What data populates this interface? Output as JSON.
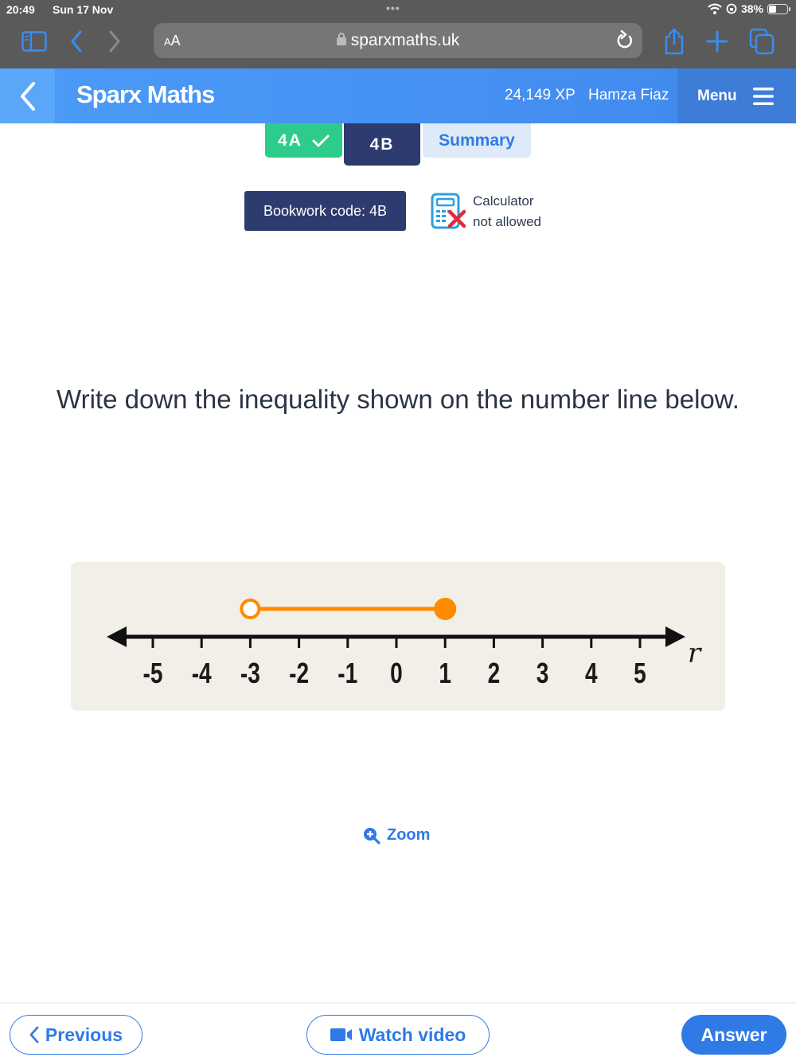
{
  "status_bar": {
    "time": "20:49",
    "date": "Sun 17 Nov",
    "battery": "38%",
    "battery_level": 0.38
  },
  "browser": {
    "text_size_label": "AA",
    "url": "sparxmaths.uk"
  },
  "header": {
    "brand": "Sparx Maths",
    "xp": "24,149 XP",
    "user_name": "Hamza Fiaz",
    "menu_label": "Menu"
  },
  "tabs": [
    {
      "label": "4A",
      "status": "complete"
    },
    {
      "label": "4B",
      "status": "active"
    },
    {
      "label": "Summary",
      "status": "inactive"
    }
  ],
  "bookwork": {
    "label": "Bookwork code: 4B"
  },
  "calculator": {
    "line1": "Calculator",
    "line2": "not allowed"
  },
  "question": {
    "text": "Write down the inequality shown on the number line below."
  },
  "number_line": {
    "min": -5,
    "max": 5,
    "ticks": [
      "-5",
      "-4",
      "-3",
      "-2",
      "-1",
      "0",
      "1",
      "2",
      "3",
      "4",
      "5"
    ],
    "variable": "r",
    "interval": {
      "start": -3,
      "start_type": "open",
      "end": 1,
      "end_type": "closed"
    },
    "colors": {
      "interval": "#ff8a00",
      "axis": "#111111"
    }
  },
  "zoom": {
    "label": "Zoom"
  },
  "footer": {
    "previous_label": "Previous",
    "watch_video_label": "Watch video",
    "answer_label": "Answer"
  },
  "colors": {
    "brand_blue": "#4590f2",
    "navy": "#2d3b6e",
    "green": "#2ecc8a",
    "link_blue": "#2f7ae5"
  }
}
